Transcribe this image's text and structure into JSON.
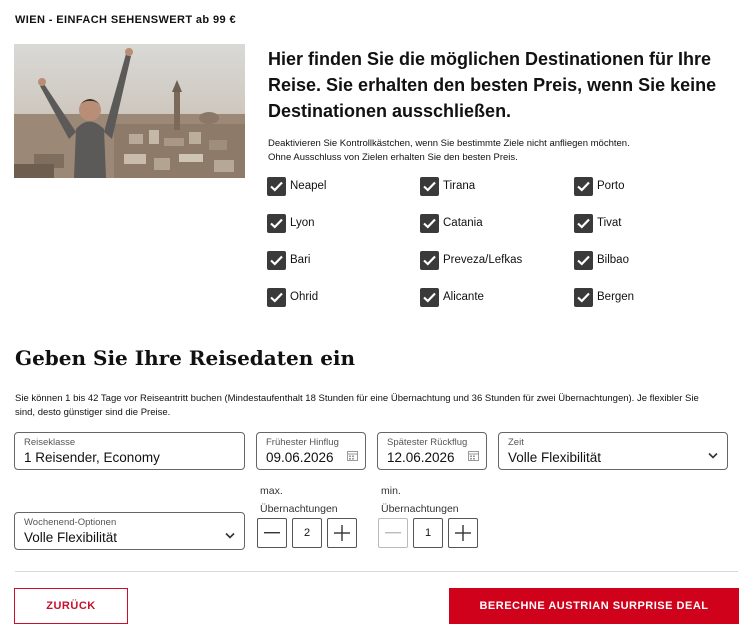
{
  "header": {
    "title": "WIEN - EINFACH SEHENSWERT ab 99 €"
  },
  "intro": {
    "heading": "Hier finden Sie die möglichen Destinationen für Ihre Reise. Sie erhalten den besten Preis, wenn Sie keine Destinationen ausschließen.",
    "description_line1": "Deaktivieren Sie Kontrollkästchen, wenn Sie bestimmte Ziele nicht anfliegen möchten.",
    "description_line2": "Ohne Ausschluss von Zielen erhalten Sie den besten Preis."
  },
  "destinations": [
    {
      "label": "Neapel",
      "checked": true
    },
    {
      "label": "Tirana",
      "checked": true
    },
    {
      "label": "Porto",
      "checked": true
    },
    {
      "label": "Lyon",
      "checked": true
    },
    {
      "label": "Catania",
      "checked": true
    },
    {
      "label": "Tivat",
      "checked": true
    },
    {
      "label": "Bari",
      "checked": true
    },
    {
      "label": "Preveza/Lefkas",
      "checked": true
    },
    {
      "label": "Bilbao",
      "checked": true
    },
    {
      "label": "Ohrid",
      "checked": true
    },
    {
      "label": "Alicante",
      "checked": true
    },
    {
      "label": "Bergen",
      "checked": true
    }
  ],
  "travel": {
    "heading": "Geben Sie Ihre Reisedaten ein",
    "description": "Sie können 1 bis 42 Tage vor Reiseantritt buchen (Mindestaufenthalt 18 Stunden für eine Übernachtung und 36 Stunden für zwei Übernachtungen). Je flexibler Sie sind, desto günstiger sind die Preise.",
    "reiseklasse": {
      "label": "Reiseklasse",
      "value": "1 Reisender, Economy"
    },
    "hinflug": {
      "label": "Frühester Hinflug",
      "value": "09.06.2026"
    },
    "rueckflug": {
      "label": "Spätester Rückflug",
      "value": "12.06.2026"
    },
    "zeit": {
      "label": "Zeit",
      "value": "Volle Flexibilität"
    },
    "wochenende": {
      "label": "Wochenend-Optionen",
      "value": "Volle Flexibilität"
    },
    "max_nights": {
      "label_line1": "max.",
      "label_line2": "Übernachtungen",
      "value": "2"
    },
    "min_nights": {
      "label_line1": "min.",
      "label_line2": "Übernachtungen",
      "value": "1"
    }
  },
  "buttons": {
    "back": "ZURÜCK",
    "calculate": "BERECHNE AUSTRIAN SURPRISE DEAL"
  },
  "colors": {
    "accent": "#d0021b",
    "checkbox": "#3a3a3a"
  }
}
